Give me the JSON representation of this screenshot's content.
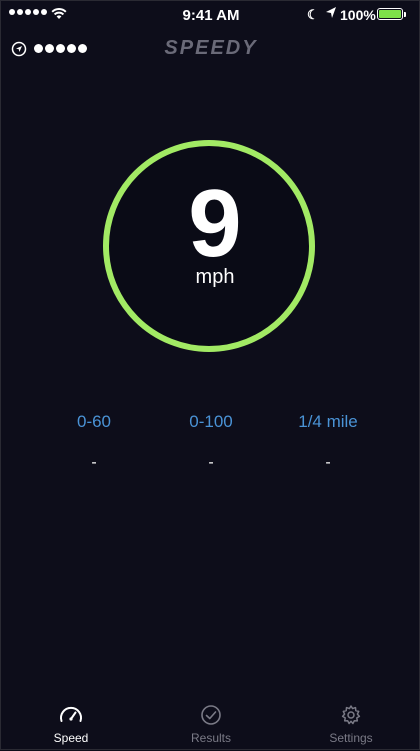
{
  "status_bar": {
    "time": "9:41 AM",
    "battery_percent": "100%",
    "signal_bars": 5
  },
  "header": {
    "title": "SPEEDY",
    "gps_strength_dots": 5
  },
  "gauge": {
    "speed_value": "9",
    "unit": "mph",
    "ring_color": "#a2ea64"
  },
  "metrics": [
    {
      "label": "0-60",
      "value": "-"
    },
    {
      "label": "0-100",
      "value": "-"
    },
    {
      "label": "1/4 mile",
      "value": "-"
    }
  ],
  "tabs": [
    {
      "label": "Speed",
      "icon": "speedometer-icon",
      "active": true
    },
    {
      "label": "Results",
      "icon": "checkmark-circle-icon",
      "active": false
    },
    {
      "label": "Settings",
      "icon": "gear-icon",
      "active": false
    }
  ],
  "colors": {
    "background": "#0d0d1a",
    "accent_green": "#a2ea64",
    "metric_blue": "#4a93d6"
  }
}
